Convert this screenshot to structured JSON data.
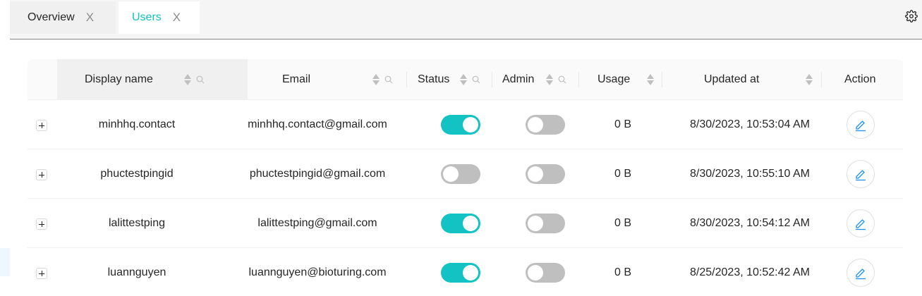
{
  "tabs": [
    {
      "label": "Overview",
      "close": "X",
      "active": false
    },
    {
      "label": "Users",
      "close": "X",
      "active": true
    }
  ],
  "table": {
    "columns": [
      "Display name",
      "Email",
      "Status",
      "Admin",
      "Usage",
      "Updated at",
      "Action"
    ],
    "rows": [
      {
        "display_name": "minhhq.contact",
        "email": "minhhq.contact@gmail.com",
        "status": true,
        "admin": false,
        "usage": "0 B",
        "updated_at": "8/30/2023, 10:53:04 AM"
      },
      {
        "display_name": "phuctestpingid",
        "email": "phuctestpingid@gmail.com",
        "status": false,
        "admin": false,
        "usage": "0 B",
        "updated_at": "8/30/2023, 10:55:10 AM"
      },
      {
        "display_name": "lalittestping",
        "email": "lalittestping@gmail.com",
        "status": true,
        "admin": false,
        "usage": "0 B",
        "updated_at": "8/30/2023, 10:54:12 AM"
      },
      {
        "display_name": "luannguyen",
        "email": "luannguyen@bioturing.com",
        "status": true,
        "admin": false,
        "usage": "0 B",
        "updated_at": "8/25/2023, 10:52:42 AM"
      }
    ]
  },
  "colors": {
    "accent": "#13c2c2",
    "switch_off": "#bfbfbf",
    "edit_icon": "#1890ff"
  },
  "icons": {
    "settings": "gear-icon",
    "edit": "pencil-icon",
    "expand": "plus-icon",
    "sort": "sort-icon",
    "filter": "search-icon"
  }
}
